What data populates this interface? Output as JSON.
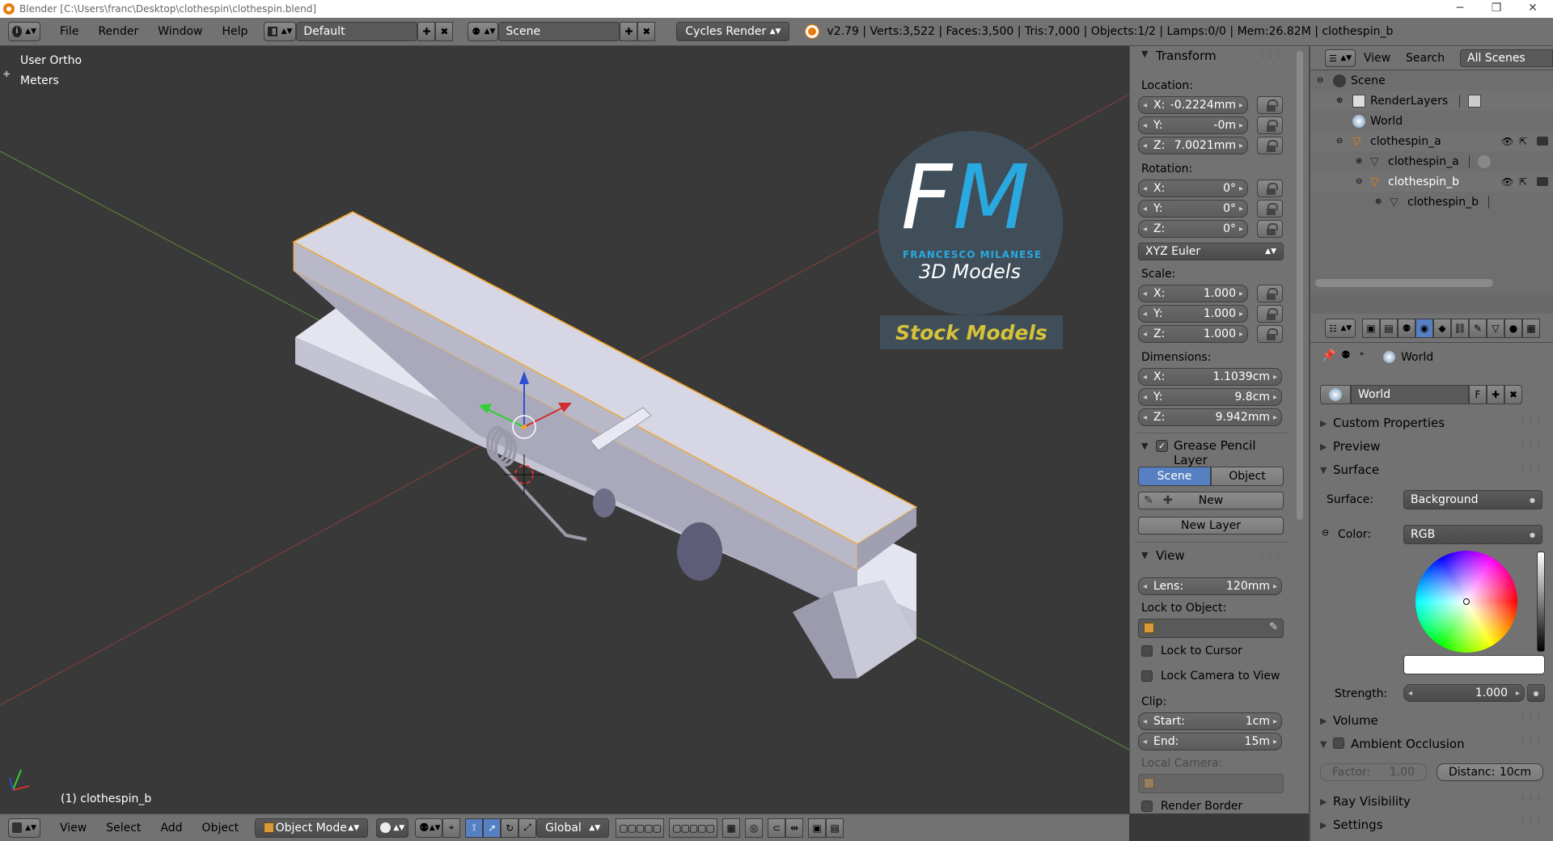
{
  "window": {
    "title": "Blender [C:\\Users\\franc\\Desktop\\clothespin\\clothespin.blend]",
    "min": "─",
    "max": "❐",
    "close": "✕"
  },
  "info_header": {
    "menus": [
      "File",
      "Render",
      "Window",
      "Help"
    ],
    "screen_layout": "Default",
    "scene": "Scene",
    "render_engine": "Cycles Render",
    "stats": "v2.79 | Verts:3,522 | Faces:3,500 | Tris:7,000 | Objects:1/2 | Lamps:0/0 | Mem:26.82M | clothespin_b"
  },
  "viewport": {
    "view_name": "User Ortho",
    "units": "Meters",
    "active_object": "(1) clothespin_b",
    "watermark": {
      "initials_f": "F",
      "initials_m": "M",
      "brand": "FRANCESCO MILANESE",
      "sub": "3D Models",
      "banner": "Stock Models"
    }
  },
  "npanel": {
    "transform_title": "Transform",
    "location_label": "Location:",
    "location": [
      {
        "axis": "X:",
        "value": "-0.2224mm"
      },
      {
        "axis": "Y:",
        "value": "-0m"
      },
      {
        "axis": "Z:",
        "value": "7.0021mm"
      }
    ],
    "rotation_label": "Rotation:",
    "rotation": [
      {
        "axis": "X:",
        "value": "0°"
      },
      {
        "axis": "Y:",
        "value": "0°"
      },
      {
        "axis": "Z:",
        "value": "0°"
      }
    ],
    "rotation_mode": "XYZ Euler",
    "scale_label": "Scale:",
    "scale": [
      {
        "axis": "X:",
        "value": "1.000"
      },
      {
        "axis": "Y:",
        "value": "1.000"
      },
      {
        "axis": "Z:",
        "value": "1.000"
      }
    ],
    "dimensions_label": "Dimensions:",
    "dimensions": [
      {
        "axis": "X:",
        "value": "1.1039cm"
      },
      {
        "axis": "Y:",
        "value": "9.8cm"
      },
      {
        "axis": "Z:",
        "value": "9.942mm"
      }
    ],
    "grease_title": "Grease Pencil Layer",
    "grease_scene": "Scene",
    "grease_object": "Object",
    "grease_new": "New",
    "grease_new_layer": "New Layer",
    "view_title": "View",
    "lens_label": "Lens:",
    "lens_value": "120mm",
    "lock_to_object": "Lock to Object:",
    "lock_cursor": "Lock to Cursor",
    "lock_camera": "Lock Camera to View",
    "clip_label": "Clip:",
    "clip_start_label": "Start:",
    "clip_start": "1cm",
    "clip_end_label": "End:",
    "clip_end": "15m",
    "local_camera": "Local Camera:",
    "render_border": "Render Border"
  },
  "outliner": {
    "header": {
      "view": "View",
      "search": "Search",
      "filter": "All Scenes"
    },
    "items": [
      {
        "label": "Scene",
        "depth": 0
      },
      {
        "label": "RenderLayers",
        "depth": 1
      },
      {
        "label": "World",
        "depth": 1
      },
      {
        "label": "clothespin_a",
        "depth": 1
      },
      {
        "label": "clothespin_a",
        "depth": 2
      },
      {
        "label": "clothespin_b",
        "depth": 2
      },
      {
        "label": "clothespin_b",
        "depth": 3
      }
    ]
  },
  "properties": {
    "context": "World",
    "world_name": "World",
    "fake_user": "F",
    "sections": {
      "custom": "Custom Properties",
      "preview": "Preview",
      "surface": "Surface",
      "volume": "Volume",
      "ao": "Ambient Occlusion",
      "ray": "Ray Visibility",
      "settings": "Settings"
    },
    "surface_label": "Surface:",
    "surface_value": "Background",
    "color_label": "Color:",
    "color_mode": "RGB",
    "strength_label": "Strength:",
    "strength_value": "1.000",
    "factor_label": "Factor:",
    "factor_value": "1.00",
    "distance_label": "Distanc:",
    "distance_value": "10cm"
  },
  "bottom_header": {
    "menus": [
      "View",
      "Select",
      "Add",
      "Object"
    ],
    "mode": "Object Mode",
    "orientation": "Global"
  },
  "colors": {
    "selected_outline": "#f5a623",
    "blender_orange": "#e87d0d",
    "accent_blue": "#5680c2",
    "panel_gray": "#727272",
    "viewport_bg": "#393939"
  }
}
